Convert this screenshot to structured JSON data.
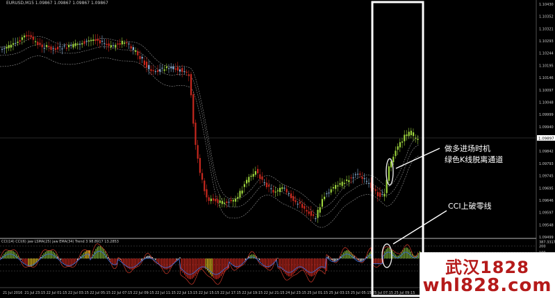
{
  "window": {
    "symbol_info": "EURUSD,M15  1.09867 1.09867 1.09867 1.09867",
    "current_price": "1.09897"
  },
  "indicator": {
    "label": "CCI(14)  CCI(6)  jaw LSMA(25)  jaw EMA(34)  Trend 3  98.8917 13.2853"
  },
  "price_axis": [
    "1.10430",
    "1.10352",
    "1.10321",
    "1.10293",
    "1.10244",
    "1.10195",
    "1.10146",
    "1.10097",
    "1.10048",
    "1.09999",
    "1.09940",
    "1.09897",
    "1.09842",
    "1.09793",
    "1.09745",
    "1.09695",
    "1.09646",
    "1.09597",
    "1.09548",
    "1.09499"
  ],
  "indicator_axis": [
    "387.3317",
    "200",
    "100",
    "0",
    "-100",
    "-200"
  ],
  "time_axis": [
    "21 Jul 2016",
    "21 Jul 23:15",
    "22 Jul 01:15",
    "22 Jul 03:15",
    "22 Jul 05:15",
    "22 Jul 07:15",
    "22 Jul 09:15",
    "22 Jul 11:15",
    "22 Jul 13:15",
    "22 Jul 15:15",
    "22 Jul 17:15",
    "22 Jul 19:15",
    "22 Jul 21:15",
    "24 Jul 23:15",
    "25 Jul 01:15",
    "25 Jul 03:15",
    "25 Jul 05:15",
    "25 Jul 07:15",
    "25 Jul 09:15"
  ],
  "annotations": {
    "long_entry_title": "做多进场时机",
    "long_entry_desc": "绿色K线脱离通道",
    "cci_note": "CCI上破零线"
  },
  "watermark": {
    "line1": "武汉1828",
    "line2": "whl828.com"
  },
  "colors": {
    "background": "#000000",
    "bull": "#9bd23c",
    "bear": "#c8281e",
    "neutral": "#8ab0d6",
    "channel": "#9a9a9a",
    "highlight": "#ffffff",
    "watermark_text": "#b51a1a"
  }
}
